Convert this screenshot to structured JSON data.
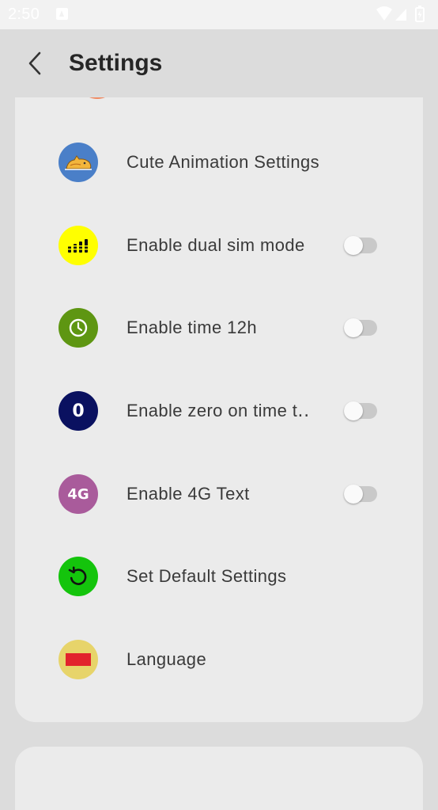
{
  "status_bar": {
    "time": "2:50",
    "icons": [
      "notification-a-icon",
      "wifi-icon",
      "signal-icon",
      "battery-icon"
    ]
  },
  "header": {
    "back_icon": "chevron-left-icon",
    "title": "Settings"
  },
  "items": [
    {
      "label": "Cute Animation Settings",
      "icon": "cat-animation-icon",
      "icon_color": "#4a7fc8"
    },
    {
      "label": "Enable dual sim mode",
      "icon": "signal-bars-icon",
      "icon_color": "#ffff00",
      "toggle": false
    },
    {
      "label": "Enable time 12h",
      "icon": "clock-icon",
      "icon_color": "#5e9612",
      "toggle": false
    },
    {
      "label": "Enable zero on time t․․",
      "icon": "zero-icon",
      "icon_text": "0",
      "icon_color": "#0a1160",
      "toggle": false
    },
    {
      "label": "Enable 4G Text",
      "icon": "4g-icon",
      "icon_text": "4G",
      "icon_color": "#a95b9b",
      "toggle": false
    },
    {
      "label": "Set Default Settings",
      "icon": "reset-icon",
      "icon_color": "#14c40c"
    },
    {
      "label": "Language",
      "icon": "language-flag-icon",
      "icon_color": "#e7d46a"
    }
  ],
  "colors": {
    "background": "#dcdcdc",
    "card": "#ebebeb",
    "toggle_track_off": "#c9c9c9"
  }
}
